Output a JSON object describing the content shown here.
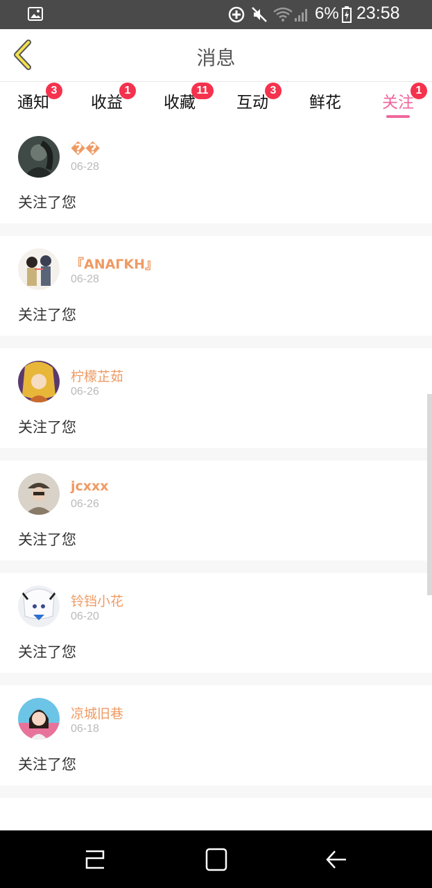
{
  "status_bar": {
    "battery_percent": "6%",
    "time": "23:58",
    "icons": [
      "gallery-icon",
      "sync-icon",
      "mute-icon",
      "wifi-icon",
      "signal-icon",
      "battery-icon"
    ]
  },
  "header": {
    "title": "消息",
    "back_icon": "chevron-left-icon"
  },
  "tabs": [
    {
      "label": "通知",
      "badge": "3",
      "active": false
    },
    {
      "label": "收益",
      "badge": "1",
      "active": false
    },
    {
      "label": "收藏",
      "badge": "11",
      "active": false
    },
    {
      "label": "互动",
      "badge": "3",
      "active": false
    },
    {
      "label": "鲜花",
      "badge": "",
      "active": false
    },
    {
      "label": "关注",
      "badge": "1",
      "active": true
    }
  ],
  "notifications": [
    {
      "username": "��",
      "date": "06-28",
      "message": "关注了您"
    },
    {
      "username": "『ΑΝΑΓΚΗ』",
      "date": "06-28",
      "message": "关注了您"
    },
    {
      "username": "柠檬芷茹",
      "date": "06-26",
      "message": "关注了您"
    },
    {
      "username": "jcxxx",
      "date": "06-26",
      "message": "关注了您"
    },
    {
      "username": "铃铛小花",
      "date": "06-20",
      "message": "关注了您"
    },
    {
      "username": "凉城旧巷",
      "date": "06-18",
      "message": "关注了您"
    }
  ],
  "colors": {
    "accent": "#f0679c",
    "username": "#ef9a63",
    "badge": "#f5324d",
    "status_bar": "#4a4a4a",
    "nav_bar": "#000000"
  },
  "nav_bar": {
    "icons": [
      "recents-icon",
      "home-icon",
      "back-icon"
    ]
  }
}
